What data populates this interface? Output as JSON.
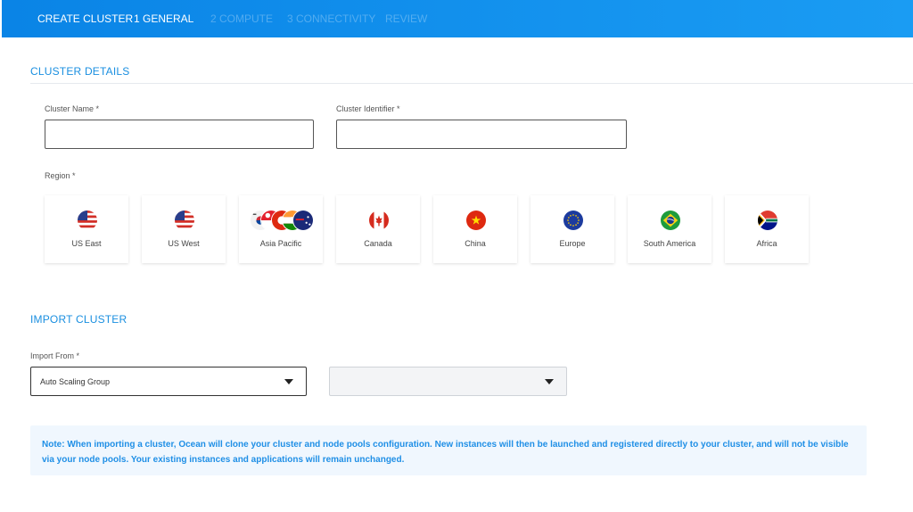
{
  "header": {
    "title": "CREATE CLUSTER",
    "steps": [
      {
        "label": "1 GENERAL",
        "active": true
      },
      {
        "label": "2 COMPUTE",
        "active": false
      },
      {
        "label": "3 CONNECTIVITY",
        "active": false
      },
      {
        "label": "REVIEW",
        "active": false
      }
    ]
  },
  "cluster_details": {
    "section_title": "CLUSTER DETAILS",
    "cluster_name_label": "Cluster Name *",
    "cluster_name_value": "",
    "cluster_identifier_label": "Cluster Identifier *",
    "cluster_identifier_value": "",
    "region_label": "Region *",
    "regions": [
      {
        "label": "US East",
        "flag": "us-flag-icon"
      },
      {
        "label": "US West",
        "flag": "us-flag-icon"
      },
      {
        "label": "Asia Pacific",
        "flag": "asia-pacific-flags-icon"
      },
      {
        "label": "Canada",
        "flag": "canada-flag-icon"
      },
      {
        "label": "China",
        "flag": "china-flag-icon"
      },
      {
        "label": "Europe",
        "flag": "eu-flag-icon"
      },
      {
        "label": "South America",
        "flag": "brazil-flag-icon"
      },
      {
        "label": "Africa",
        "flag": "south-africa-flag-icon"
      }
    ]
  },
  "import_cluster": {
    "section_title": "IMPORT CLUSTER",
    "import_from_label": "Import From *",
    "import_from_value": "Auto Scaling Group",
    "secondary_value": "",
    "note": "Note: When importing a cluster, Ocean will clone your cluster and node pools configuration. New instances will then be launched and registered directly to your cluster, and will not be visible via your node pools. Your existing instances and applications will remain unchanged."
  },
  "colors": {
    "header_blue": "#0a84e6",
    "accent_blue": "#1a8fe0",
    "note_bg": "#f0f7fe"
  }
}
